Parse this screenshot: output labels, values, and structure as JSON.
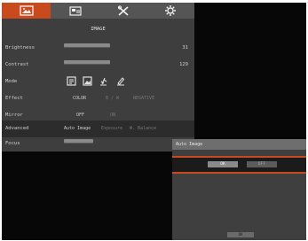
{
  "tabs": [
    {
      "icon": "image-tab-icon",
      "active": true
    },
    {
      "icon": "display-tab-icon",
      "active": false
    },
    {
      "icon": "tools-tab-icon",
      "active": false
    },
    {
      "icon": "settings-tab-icon",
      "active": false
    }
  ],
  "panel": {
    "title": "IMAGE"
  },
  "settings": {
    "brightness": {
      "label": "Brightness",
      "value": "31",
      "level": 0.52
    },
    "contrast": {
      "label": "Contrast",
      "value": "129",
      "level": 0.5
    },
    "mode": {
      "label": "Mode",
      "icons": [
        "document-mode-icon",
        "photo-mode-icon",
        "microscope-mode-icon",
        "pen-mode-icon"
      ]
    },
    "effect": {
      "label": "Effect",
      "options": [
        "COLOR",
        "B / W",
        "NEGATIVE"
      ],
      "selected": "COLOR"
    },
    "mirror": {
      "label": "Mirror",
      "options": [
        "OFF",
        "ON"
      ],
      "selected": "OFF"
    },
    "advanced": {
      "label": "Advanced",
      "options": [
        "Auto Image",
        "Exposure",
        "W. Balance"
      ],
      "selected": "Auto Image"
    },
    "focus": {
      "label": "Focus"
    }
  },
  "popup": {
    "title": "Auto Image",
    "ok_label": "OK",
    "cancel_label": "OFF",
    "bottom_label": "OK"
  },
  "colors": {
    "accent": "#c94a1d",
    "panel": "#3e3e3e",
    "tabbar": "#555555"
  }
}
